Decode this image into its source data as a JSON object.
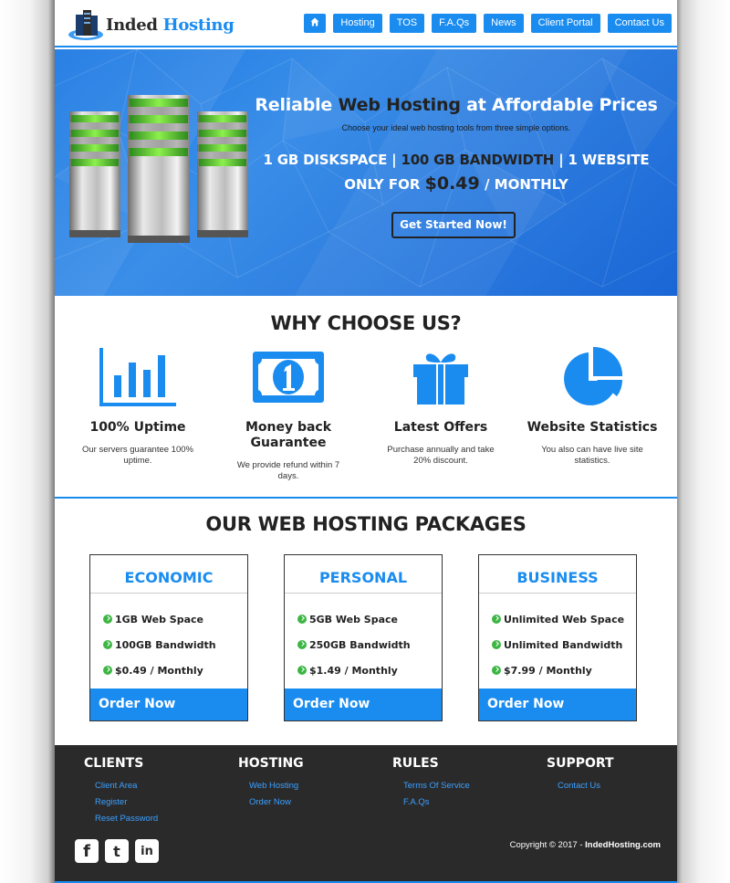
{
  "brand": {
    "name_part1": "Inded",
    "name_part2": "Hosting"
  },
  "nav": [
    "Hosting",
    "TOS",
    "F.A.Qs",
    "News",
    "Client Portal",
    "Contact Us"
  ],
  "nav_home_icon": "home-icon",
  "hero": {
    "title_a": "Reliable ",
    "title_b": "Web Hosting",
    "title_c": " at Affordable Prices",
    "subtitle": "Choose your ideal web hosting tools from three simple options.",
    "spec_a": "1 GB DISKSPACE | ",
    "spec_b": "100 GB BANDWIDTH",
    "spec_c": " | 1 WEBSITE",
    "price_prefix": "ONLY FOR ",
    "price": "$0.49",
    "price_suffix": " / MONTHLY",
    "cta": "Get Started Now!"
  },
  "why": {
    "title": "WHY CHOOSE US?",
    "features": [
      {
        "icon": "bar-chart-icon",
        "title": "100% Uptime",
        "desc": "Our servers guarantee 100% uptime."
      },
      {
        "icon": "money-bill-icon",
        "title": "Money back Guarantee",
        "desc": "We provide refund within 7 days."
      },
      {
        "icon": "gift-icon",
        "title": "Latest Offers",
        "desc": "Purchase annually and take 20% discount."
      },
      {
        "icon": "pie-chart-icon",
        "title": "Website Statistics",
        "desc": "You also can have live site statistics."
      }
    ]
  },
  "packages": {
    "title": "OUR WEB HOSTING PACKAGES",
    "items": [
      {
        "name": "ECONOMIC",
        "features": [
          "1GB Web Space",
          "100GB Bandwidth",
          "$0.49 / Monthly"
        ],
        "cta": "Order Now"
      },
      {
        "name": "PERSONAL",
        "features": [
          "5GB Web Space",
          "250GB Bandwidth",
          "$1.49 / Monthly"
        ],
        "cta": "Order Now"
      },
      {
        "name": "BUSINESS",
        "features": [
          "Unlimited Web Space",
          "Unlimited Bandwidth",
          "$7.99 / Monthly"
        ],
        "cta": "Order Now"
      }
    ]
  },
  "footer": {
    "columns": [
      {
        "title": "CLIENTS",
        "links": [
          "Client Area",
          "Register",
          "Reset Password"
        ]
      },
      {
        "title": "HOSTING",
        "links": [
          "Web Hosting",
          "Order Now"
        ]
      },
      {
        "title": "RULES",
        "links": [
          "Terms Of Service",
          "F.A.Qs"
        ]
      },
      {
        "title": "SUPPORT",
        "links": [
          "Contact Us"
        ]
      }
    ],
    "social": {
      "facebook": "f",
      "twitter": "t",
      "linkedin": "in"
    },
    "copyright": "Copyright © 2017 - ",
    "copyright_site": "IndedHosting.com"
  },
  "colors": {
    "accent": "#1a8cf0",
    "dark": "#2b2a2b",
    "check": "#3cb643"
  }
}
